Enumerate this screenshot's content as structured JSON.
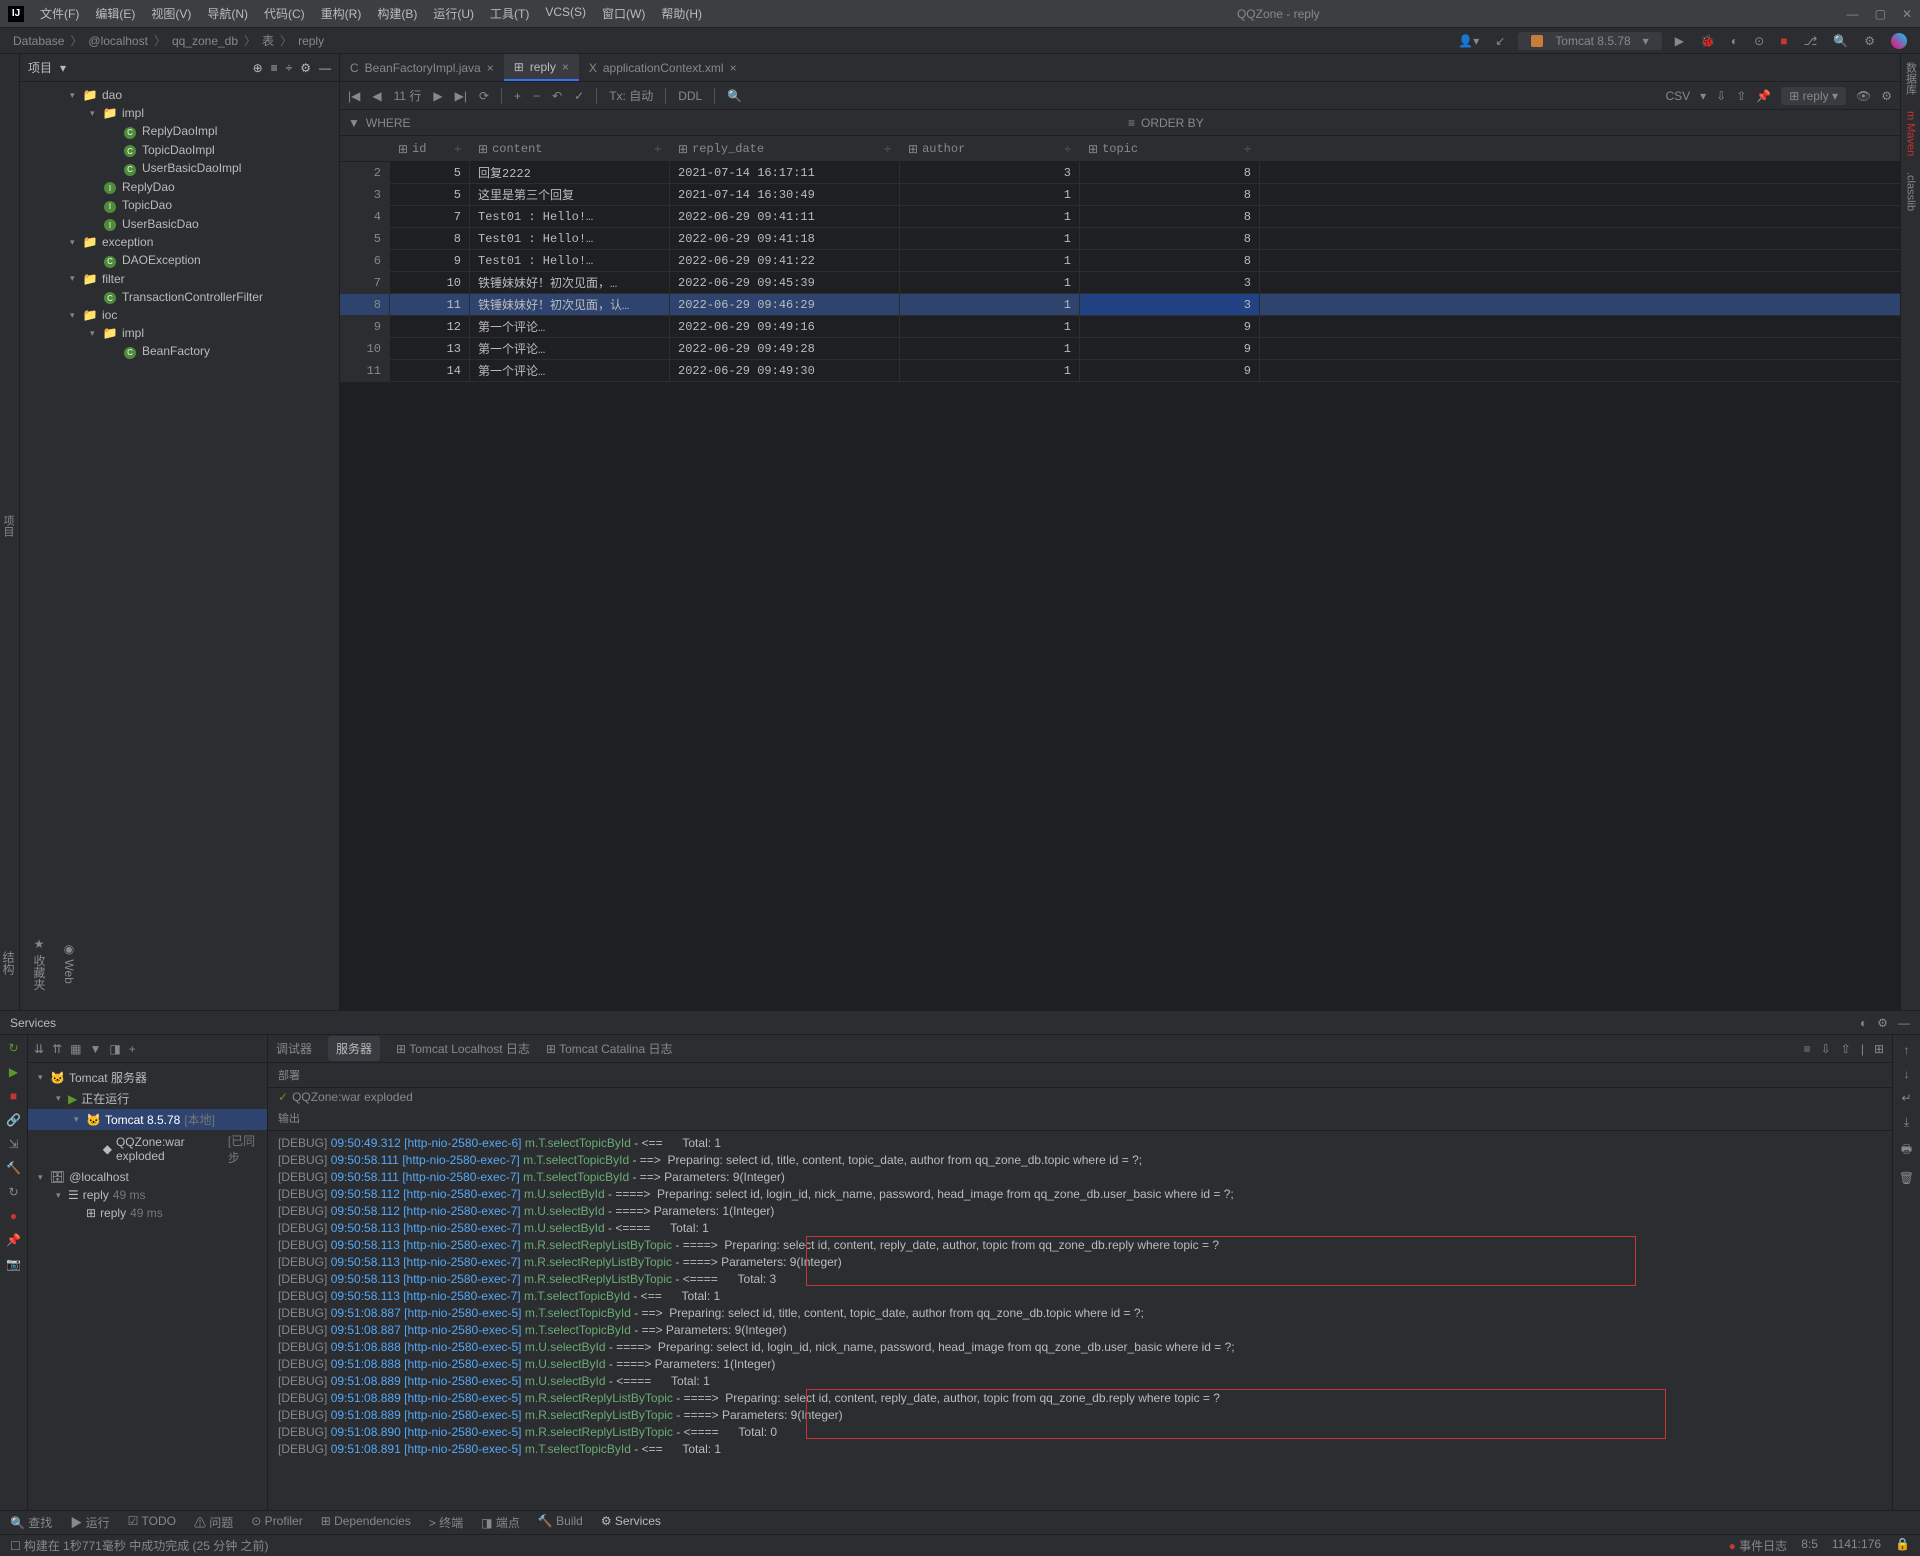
{
  "window_title": "QQZone - reply",
  "menu": [
    "文件(F)",
    "编辑(E)",
    "视图(V)",
    "导航(N)",
    "代码(C)",
    "重构(R)",
    "构建(B)",
    "运行(U)",
    "工具(T)",
    "VCS(S)",
    "窗口(W)",
    "帮助(H)"
  ],
  "breadcrumb": [
    "Database",
    "@localhost",
    "qq_zone_db",
    "表",
    "reply"
  ],
  "runconfig_label": "Tomcat 8.5.78",
  "project_header": "项目",
  "tree": [
    {
      "indent": 50,
      "arrow": "▾",
      "icon": "📁",
      "label": "dao"
    },
    {
      "indent": 70,
      "arrow": "▾",
      "icon": "📁",
      "label": "impl"
    },
    {
      "indent": 90,
      "arrow": "",
      "icon": "C",
      "label": "ReplyDaoImpl"
    },
    {
      "indent": 90,
      "arrow": "",
      "icon": "C",
      "label": "TopicDaoImpl"
    },
    {
      "indent": 90,
      "arrow": "",
      "icon": "C",
      "label": "UserBasicDaoImpl"
    },
    {
      "indent": 70,
      "arrow": "",
      "icon": "I",
      "label": "ReplyDao"
    },
    {
      "indent": 70,
      "arrow": "",
      "icon": "I",
      "label": "TopicDao"
    },
    {
      "indent": 70,
      "arrow": "",
      "icon": "I",
      "label": "UserBasicDao"
    },
    {
      "indent": 50,
      "arrow": "▾",
      "icon": "📁",
      "label": "exception"
    },
    {
      "indent": 70,
      "arrow": "",
      "icon": "C",
      "label": "DAOException"
    },
    {
      "indent": 50,
      "arrow": "▾",
      "icon": "📁",
      "label": "filter"
    },
    {
      "indent": 70,
      "arrow": "",
      "icon": "C",
      "label": "TransactionControllerFilter"
    },
    {
      "indent": 50,
      "arrow": "▾",
      "icon": "📁",
      "label": "ioc"
    },
    {
      "indent": 70,
      "arrow": "▾",
      "icon": "📁",
      "label": "impl"
    },
    {
      "indent": 90,
      "arrow": "",
      "icon": "C",
      "label": "BeanFactory"
    }
  ],
  "editor_tabs": [
    {
      "label": "BeanFactoryImpl.java",
      "active": false,
      "icon": "C"
    },
    {
      "label": "reply",
      "active": true,
      "icon": "⊞"
    },
    {
      "label": "applicationContext.xml",
      "active": false,
      "icon": "X"
    }
  ],
  "db_toolbar": {
    "rows": "11 行",
    "tx": "Tx: 自动",
    "ddl": "DDL",
    "csv": "CSV",
    "reply_btn": "reply"
  },
  "db_filter": {
    "where": "WHERE",
    "orderby": "ORDER BY"
  },
  "db_columns": [
    "id",
    "content",
    "reply_date",
    "author",
    "topic"
  ],
  "db_rows": [
    {
      "n": 2,
      "id": 5,
      "content": "回复2222",
      "date": "2021-07-14 16:17:11",
      "author": 3,
      "topic": 8
    },
    {
      "n": 3,
      "id": 5,
      "content": "这里是第三个回复",
      "date": "2021-07-14 16:30:49",
      "author": 1,
      "topic": 8
    },
    {
      "n": 4,
      "id": 7,
      "content": "Test01 : Hello!…",
      "date": "2022-06-29 09:41:11",
      "author": 1,
      "topic": 8
    },
    {
      "n": 5,
      "id": 8,
      "content": "Test01 : Hello!…",
      "date": "2022-06-29 09:41:18",
      "author": 1,
      "topic": 8
    },
    {
      "n": 6,
      "id": 9,
      "content": "Test01 : Hello!…",
      "date": "2022-06-29 09:41:22",
      "author": 1,
      "topic": 8
    },
    {
      "n": 7,
      "id": 10,
      "content": "铁锤妹妹好！初次见面，…",
      "date": "2022-06-29 09:45:39",
      "author": 1,
      "topic": 3
    },
    {
      "n": 8,
      "id": 11,
      "content": "铁锤妹妹好！初次见面，认…",
      "date": "2022-06-29 09:46:29",
      "author": 1,
      "topic": 3,
      "selected": true
    },
    {
      "n": 9,
      "id": 12,
      "content": "第一个评论…",
      "date": "2022-06-29 09:49:16",
      "author": 1,
      "topic": 9
    },
    {
      "n": 10,
      "id": 13,
      "content": "第一个评论…",
      "date": "2022-06-29 09:49:28",
      "author": 1,
      "topic": 9
    },
    {
      "n": 11,
      "id": 14,
      "content": "第一个评论…",
      "date": "2022-06-29 09:49:30",
      "author": 1,
      "topic": 9
    }
  ],
  "services": {
    "title": "Services",
    "tree": [
      {
        "indent": 10,
        "arrow": "▾",
        "label": "Tomcat 服务器",
        "icon": "🐱"
      },
      {
        "indent": 28,
        "arrow": "▾",
        "label": "正在运行",
        "icon": "▶",
        "cls": "play-icon"
      },
      {
        "indent": 46,
        "arrow": "▾",
        "label": "Tomcat 8.5.78",
        "dim": "[本地]",
        "icon": "🐱",
        "selected": true
      },
      {
        "indent": 64,
        "arrow": "",
        "label": "QQZone:war exploded",
        "dim": "[已同步",
        "icon": "◆"
      },
      {
        "indent": 10,
        "arrow": "▾",
        "label": "@localhost",
        "icon": "🗄"
      },
      {
        "indent": 28,
        "arrow": "▾",
        "label": "reply",
        "dim": "49 ms",
        "icon": "☰"
      },
      {
        "indent": 46,
        "arrow": "",
        "label": "reply",
        "dim": "49 ms",
        "icon": "⊞"
      }
    ],
    "console_tabs": [
      "调试器",
      "服务器",
      "Tomcat Localhost 日志",
      "Tomcat Catalina 日志"
    ],
    "deploy_section": "部署",
    "deploy_line": "QQZone:war exploded",
    "output_section": "输出"
  },
  "log_lines": [
    {
      "t": "09:50:49.312",
      "th": "[http-nio-2580-exec-6]",
      "m": "m.T.selectTopicById",
      "txt": " - <==      Total: 1"
    },
    {
      "t": "09:50:58.111",
      "th": "[http-nio-2580-exec-7]",
      "m": "m.T.selectTopicById",
      "txt": " - ==>  Preparing: select id, title, content, topic_date, author from qq_zone_db.topic where id = ?;"
    },
    {
      "t": "09:50:58.111",
      "th": "[http-nio-2580-exec-7]",
      "m": "m.T.selectTopicById",
      "txt": " - ==> Parameters: 9(Integer)"
    },
    {
      "t": "09:50:58.112",
      "th": "[http-nio-2580-exec-7]",
      "m": "m.U.selectById",
      "txt": " - ====>  Preparing: select id, login_id, nick_name, password, head_image from qq_zone_db.user_basic where id = ?;"
    },
    {
      "t": "09:50:58.112",
      "th": "[http-nio-2580-exec-7]",
      "m": "m.U.selectById",
      "txt": " - ====> Parameters: 1(Integer)"
    },
    {
      "t": "09:50:58.113",
      "th": "[http-nio-2580-exec-7]",
      "m": "m.U.selectById",
      "txt": " - <====      Total: 1"
    },
    {
      "t": "09:50:58.113",
      "th": "[http-nio-2580-exec-7]",
      "m": "m.R.selectReplyListByTopic",
      "txt": " - ====>  Preparing: select id, content, reply_date, author, topic from qq_zone_db.reply where topic = ?"
    },
    {
      "t": "09:50:58.113",
      "th": "[http-nio-2580-exec-7]",
      "m": "m.R.selectReplyListByTopic",
      "txt": " - ====> Parameters: 9(Integer)"
    },
    {
      "t": "09:50:58.113",
      "th": "[http-nio-2580-exec-7]",
      "m": "m.R.selectReplyListByTopic",
      "txt": " - <====      Total: 3"
    },
    {
      "t": "09:50:58.113",
      "th": "[http-nio-2580-exec-7]",
      "m": "m.T.selectTopicById",
      "txt": " - <==      Total: 1"
    },
    {
      "t": "09:51:08.887",
      "th": "[http-nio-2580-exec-5]",
      "m": "m.T.selectTopicById",
      "txt": " - ==>  Preparing: select id, title, content, topic_date, author from qq_zone_db.topic where id = ?;"
    },
    {
      "t": "09:51:08.887",
      "th": "[http-nio-2580-exec-5]",
      "m": "m.T.selectTopicById",
      "txt": " - ==> Parameters: 9(Integer)"
    },
    {
      "t": "09:51:08.888",
      "th": "[http-nio-2580-exec-5]",
      "m": "m.U.selectById",
      "txt": " - ====>  Preparing: select id, login_id, nick_name, password, head_image from qq_zone_db.user_basic where id = ?;"
    },
    {
      "t": "09:51:08.888",
      "th": "[http-nio-2580-exec-5]",
      "m": "m.U.selectById",
      "txt": " - ====> Parameters: 1(Integer)"
    },
    {
      "t": "09:51:08.889",
      "th": "[http-nio-2580-exec-5]",
      "m": "m.U.selectById",
      "txt": " - <====      Total: 1"
    },
    {
      "t": "09:51:08.889",
      "th": "[http-nio-2580-exec-5]",
      "m": "m.R.selectReplyListByTopic",
      "txt": " - ====>  Preparing: select id, content, reply_date, author, topic from qq_zone_db.reply where topic = ?"
    },
    {
      "t": "09:51:08.889",
      "th": "[http-nio-2580-exec-5]",
      "m": "m.R.selectReplyListByTopic",
      "txt": " - ====> Parameters: 9(Integer)"
    },
    {
      "t": "09:51:08.890",
      "th": "[http-nio-2580-exec-5]",
      "m": "m.R.selectReplyListByTopic",
      "txt": " - <====      Total: 0"
    },
    {
      "t": "09:51:08.891",
      "th": "[http-nio-2580-exec-5]",
      "m": "m.T.selectTopicById",
      "txt": " - <==      Total: 1"
    }
  ],
  "bottom_bar": [
    "查找",
    "运行",
    "TODO",
    "问题",
    "Profiler",
    "Dependencies",
    "终端",
    "端点",
    "Build",
    "Services"
  ],
  "status": {
    "build": "构建在 1秒771毫秒 中成功完成 (25 分钟 之前)",
    "events": "事件日志",
    "pos": "8:5",
    "coord": "1141:176"
  }
}
